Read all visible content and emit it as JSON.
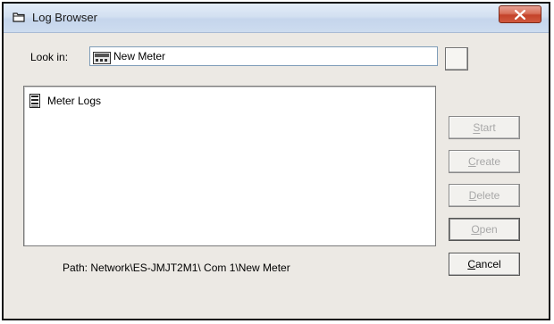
{
  "window": {
    "title": "Log Browser",
    "title_icon": "folder-icon",
    "close_icon": "close-icon"
  },
  "lookin": {
    "label": "Look in:",
    "value": "New Meter",
    "icon": "meter-icon"
  },
  "list": {
    "items": [
      {
        "label": "Meter Logs",
        "icon": "log-file-icon"
      }
    ]
  },
  "path": {
    "text": "Path:  Network\\ES-JMJT2M1\\ Com 1\\New Meter"
  },
  "buttons": {
    "start": {
      "label": "Start",
      "enabled": false
    },
    "create": {
      "label": "Create",
      "enabled": false
    },
    "delete": {
      "label": "Delete",
      "enabled": false
    },
    "open": {
      "label": "Open",
      "enabled": false
    },
    "cancel": {
      "label": "Cancel",
      "enabled": true
    }
  },
  "colors": {
    "titlebar": "#d3e0f1",
    "close_button": "#c4432a",
    "window_bg": "#ece9e4",
    "disabled_text": "#a8a8a8"
  }
}
